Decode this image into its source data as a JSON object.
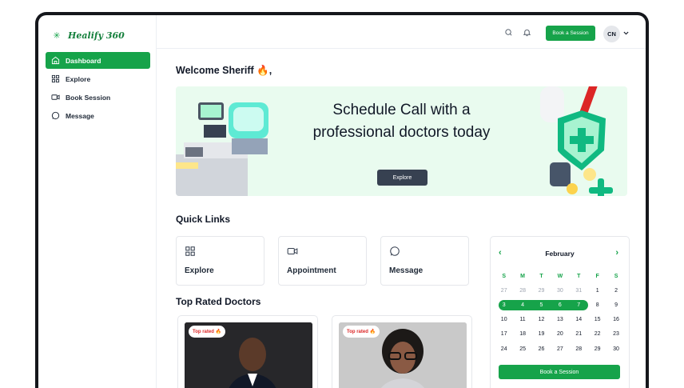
{
  "app": {
    "brand": "Healify 360"
  },
  "sidebar": {
    "items": [
      {
        "label": "Dashboard",
        "icon": "home-icon",
        "active": true
      },
      {
        "label": "Explore",
        "icon": "grid-icon",
        "active": false
      },
      {
        "label": "Book Session",
        "icon": "video-icon",
        "active": false
      },
      {
        "label": "Message",
        "icon": "chat-icon",
        "active": false
      }
    ]
  },
  "header": {
    "book_label": "Book a Session",
    "avatar_initials": "CN"
  },
  "main": {
    "welcome": "Welcome Sheriff 🔥,",
    "banner": {
      "title": "Schedule Call with a professional doctors today",
      "button": "Explore"
    },
    "quick_links_title": "Quick Links",
    "quick_links": [
      {
        "label": "Explore",
        "icon": "grid-icon"
      },
      {
        "label": "Appointment",
        "icon": "video-icon"
      },
      {
        "label": "Message",
        "icon": "chat-icon"
      }
    ],
    "doctors_title": "Top Rated Doctors",
    "doctors": [
      {
        "badge": "Top rated 🔥"
      },
      {
        "badge": "Top rated 🔥"
      }
    ]
  },
  "calendar": {
    "month": "February",
    "weekdays": [
      "S",
      "M",
      "T",
      "W",
      "T",
      "F",
      "S"
    ],
    "weeks": [
      [
        "27",
        "28",
        "29",
        "30",
        "31",
        "1",
        "2"
      ],
      [
        "3",
        "4",
        "5",
        "6",
        "7",
        "8",
        "9"
      ],
      [
        "10",
        "11",
        "12",
        "13",
        "14",
        "15",
        "16"
      ],
      [
        "17",
        "18",
        "19",
        "20",
        "21",
        "22",
        "23"
      ],
      [
        "24",
        "25",
        "26",
        "27",
        "28",
        "29",
        "30"
      ]
    ],
    "selected_range": [
      "3",
      "7"
    ],
    "button": "Book a Session"
  },
  "colors": {
    "accent": "#16a34a",
    "banner_bg": "#e9fbef",
    "dark_button": "#374151"
  }
}
